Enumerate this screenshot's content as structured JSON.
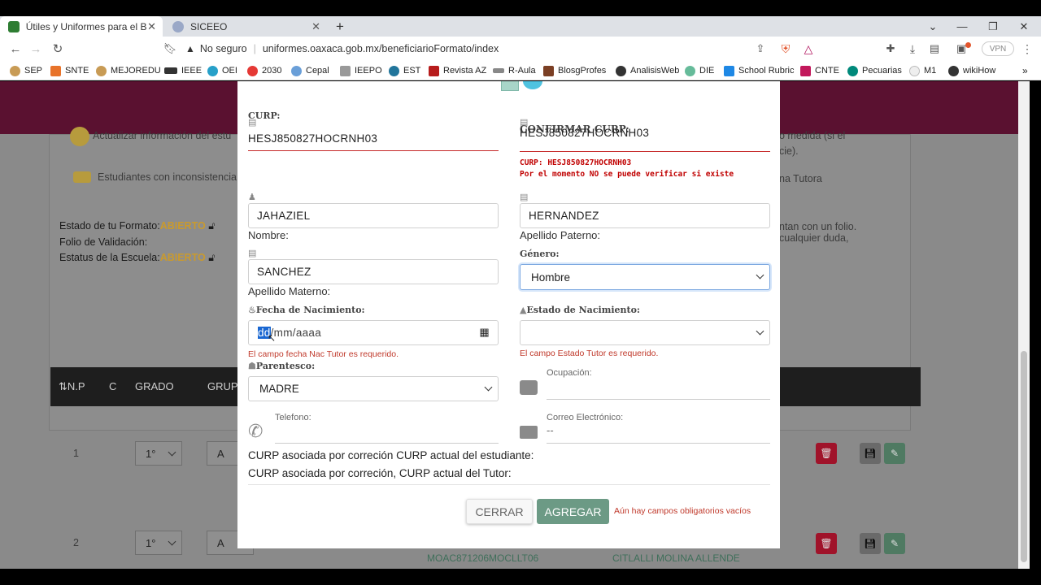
{
  "browser": {
    "tabs": [
      {
        "title": "Útiles y Uniformes para el Bienest",
        "active": true
      },
      {
        "title": "SICEEO",
        "active": false
      }
    ],
    "security_label": "No seguro",
    "url": "uniformes.oaxaca.gob.mx/beneficiarioFormato/index",
    "vpn_label": "VPN",
    "bookmarks": [
      "SEP",
      "SNTE",
      "MEJOREDU",
      "IEEE",
      "OEI",
      "2030",
      "Cepal",
      "IEEPO",
      "EST",
      "Revista AZ",
      "R-Aula",
      "BlosgProfes",
      "AnalisisWeb",
      "DIE",
      "School Rubric",
      "CNTE",
      "Pecuarias",
      "M1",
      "wikiHow"
    ]
  },
  "background": {
    "notice_1": "Actualizar información del estu",
    "notice_1_right": "o medida (si el",
    "notice_1_right2": "cie).",
    "notice_2": "Estudiantes con inconsistencia",
    "notice_2_right": "na Tutora",
    "estado_label": "Estado de tu Formato:",
    "estado_value": "ABIERTO",
    "folio_label": "Folio de Validación:",
    "estatus_label": "Estatus de la Escuela:",
    "estatus_value": "ABIERTO",
    "side_note_1": "ntan con un folio.",
    "side_note_2": "cualquier duda,",
    "table_headers": [
      "N.P",
      "C",
      "GRADO",
      "GRUP"
    ],
    "rows": [
      {
        "np": "1",
        "grado": "1°",
        "grupo": "A"
      },
      {
        "np": "2",
        "grado": "1°",
        "grupo": "A",
        "curp": "MOAC871206MOCLLT06",
        "name": "CITLALLI MOLINA ALLENDE"
      }
    ]
  },
  "modal": {
    "curp_label": "CURP:",
    "curp_value": "HESJ850827HOCRNH03",
    "confirm_label": "CONFIRMAR CURP:",
    "confirm_value": "HESJ850827HOCRNH03",
    "curp_msg_1": "CURP: HESJ850827HOCRNH03",
    "curp_msg_2": "Por el momento NO se puede verificar si existe",
    "nombre_value": "JAHAZIEL",
    "nombre_label": "Nombre:",
    "paterno_value": "HERNANDEZ",
    "paterno_label": "Apellido Paterno:",
    "materno_value": "SANCHEZ",
    "materno_label": "Apellido Materno:",
    "genero_label": "Género:",
    "genero_value": "Hombre",
    "fecha_label": "Fecha de Nacimiento:",
    "fecha_placeholder_sel": "dd",
    "fecha_placeholder_rest": "/mm/aaaa",
    "fecha_error": "El campo fecha Nac Tutor es requerido.",
    "estado_nac_label": "Estado de Nacimiento:",
    "estado_nac_value": "",
    "estado_error": "El campo Estado Tutor es requerido.",
    "parentesco_label": "Parentesco:",
    "parentesco_value": "MADRE",
    "ocupacion_label": "Ocupación:",
    "ocupacion_value": "",
    "telefono_label": "Telefono:",
    "telefono_value": "",
    "correo_label": "Correo Electrónico:",
    "correo_value": "--",
    "curp_est_line": "CURP asociada por correción CURP actual del estudiante:",
    "curp_tutor_line": "CURP asociada por correción, CURP actual del Tutor:",
    "cerrar_label": "CERRAR",
    "agregar_label": "AGREGAR",
    "warning": "Aún hay campos obligatorios vacíos"
  },
  "colors": {
    "header": "#5a1130",
    "accent_green": "#6c9a85",
    "error_red": "#c62828",
    "abierto_gold": "#d4a93a",
    "select_focus": "#7aa7e0"
  }
}
